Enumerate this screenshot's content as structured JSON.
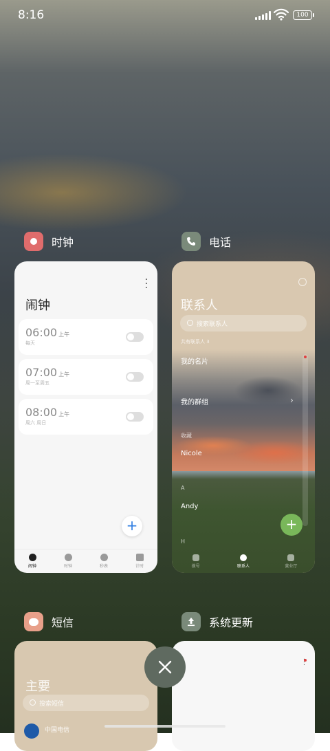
{
  "status_bar": {
    "time": "8:16",
    "battery": "100"
  },
  "apps": [
    {
      "name": "时钟",
      "icon": "clock-app-icon",
      "icon_color": "#e06c6c",
      "screen": {
        "title": "闹钟",
        "alarms": [
          {
            "time": "06:00",
            "period": "上午",
            "repeat": "每天"
          },
          {
            "time": "07:00",
            "period": "上午",
            "repeat": "周一至周五"
          },
          {
            "time": "08:00",
            "period": "上午",
            "repeat": "周六 周日"
          }
        ],
        "add_button": "+",
        "tabs": [
          "闹钟",
          "时钟",
          "秒表",
          "计时"
        ]
      }
    },
    {
      "name": "电话",
      "icon": "phone-app-icon",
      "icon_color": "#7a8a7a",
      "screen": {
        "title": "联系人",
        "search_placeholder": "搜索联系人",
        "count_label": "共有联系人 3",
        "rows": [
          "我的名片",
          "我的群组",
          "收藏",
          "Nicole",
          "A",
          "Andy",
          "H"
        ],
        "add_button": "+",
        "tabs": [
          "拨号",
          "联系人",
          "营业厅"
        ]
      }
    },
    {
      "name": "短信",
      "icon": "sms-app-icon",
      "icon_color": "#e8a08a",
      "screen": {
        "title": "主要",
        "search_placeholder": "搜索短信",
        "first_row": "中国电信"
      }
    },
    {
      "name": "系统更新",
      "icon": "update-app-icon",
      "icon_color": "#7a8a7a",
      "screen": {}
    }
  ],
  "close_button": "×"
}
